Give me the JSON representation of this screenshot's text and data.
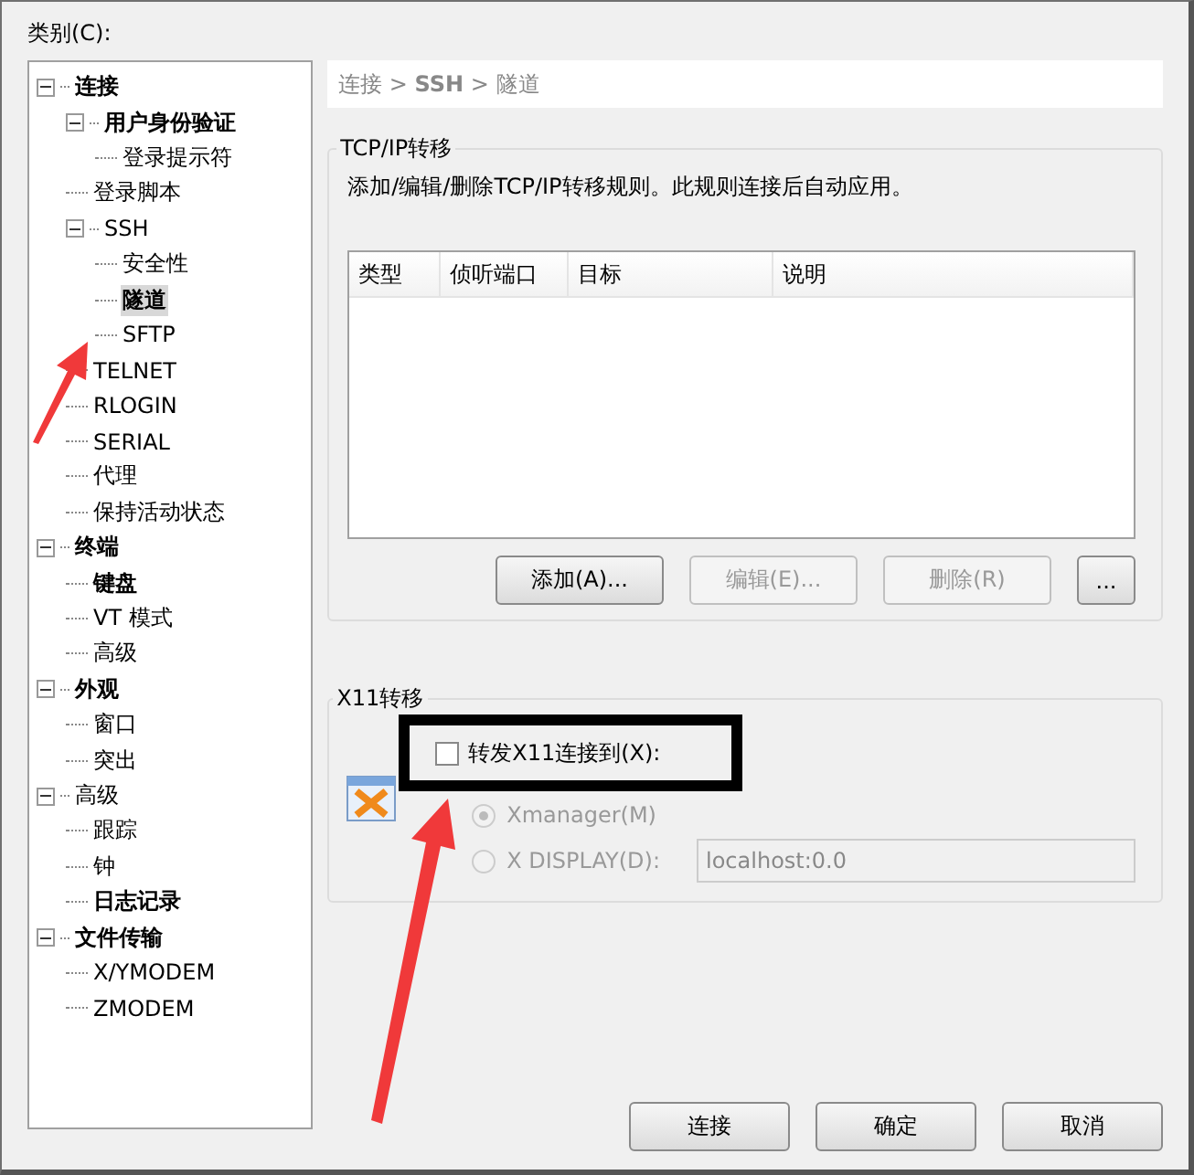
{
  "category_label": "类别(C):",
  "tree": [
    {
      "label": "连接",
      "bold": true,
      "selected": false,
      "expanded": true,
      "children": [
        {
          "label": "用户身份验证",
          "bold": true,
          "selected": false,
          "expanded": true,
          "children": [
            {
              "label": "登录提示符",
              "bold": false,
              "selected": false
            }
          ]
        },
        {
          "label": "登录脚本",
          "bold": false,
          "selected": false
        },
        {
          "label": "SSH",
          "bold": false,
          "selected": false,
          "expanded": true,
          "children": [
            {
              "label": "安全性",
              "bold": false,
              "selected": false
            },
            {
              "label": "隧道",
              "bold": true,
              "selected": true
            },
            {
              "label": "SFTP",
              "bold": false,
              "selected": false
            }
          ]
        },
        {
          "label": "TELNET",
          "bold": false,
          "selected": false
        },
        {
          "label": "RLOGIN",
          "bold": false,
          "selected": false
        },
        {
          "label": "SERIAL",
          "bold": false,
          "selected": false
        },
        {
          "label": "代理",
          "bold": false,
          "selected": false
        },
        {
          "label": "保持活动状态",
          "bold": false,
          "selected": false
        }
      ]
    },
    {
      "label": "终端",
      "bold": true,
      "selected": false,
      "expanded": true,
      "children": [
        {
          "label": "键盘",
          "bold": true,
          "selected": false
        },
        {
          "label": "VT 模式",
          "bold": false,
          "selected": false
        },
        {
          "label": "高级",
          "bold": false,
          "selected": false
        }
      ]
    },
    {
      "label": "外观",
      "bold": true,
      "selected": false,
      "expanded": true,
      "children": [
        {
          "label": "窗口",
          "bold": false,
          "selected": false
        },
        {
          "label": "突出",
          "bold": false,
          "selected": false
        }
      ]
    },
    {
      "label": "高级",
      "bold": false,
      "selected": false,
      "expanded": true,
      "children": [
        {
          "label": "跟踪",
          "bold": false,
          "selected": false
        },
        {
          "label": "钟",
          "bold": false,
          "selected": false
        },
        {
          "label": "日志记录",
          "bold": true,
          "selected": false
        }
      ]
    },
    {
      "label": "文件传输",
      "bold": true,
      "selected": false,
      "expanded": true,
      "children": [
        {
          "label": "X/YMODEM",
          "bold": false,
          "selected": false
        },
        {
          "label": "ZMODEM",
          "bold": false,
          "selected": false
        }
      ]
    }
  ],
  "breadcrumb": "连接 > **SSH** > 隧道",
  "tcp_group": {
    "title": "TCP/IP转移",
    "description": "添加/编辑/删除TCP/IP转移规则。此规则连接后自动应用。",
    "table": {
      "columns": [
        "类型",
        "侦听端口",
        "目标",
        "说明"
      ]
    },
    "buttons": [
      {
        "label": "添加(A)...",
        "disabled": false
      },
      {
        "label": "编辑(E)...",
        "disabled": true
      },
      {
        "label": "删除(R)",
        "disabled": true
      },
      {
        "label": "...",
        "disabled": false
      }
    ]
  },
  "x11_group": {
    "title": "X11转移",
    "forward": {
      "label": "转发X11连接到(X):",
      "checked": false
    },
    "options": [
      {
        "label": "Xmanager(M)",
        "selected": true,
        "disabled": true
      },
      {
        "label": "X DISPLAY(D):",
        "selected": false,
        "disabled": true
      }
    ],
    "display_value": "localhost:0.0"
  },
  "footer_buttons": [
    "连接",
    "确定",
    "取消"
  ]
}
